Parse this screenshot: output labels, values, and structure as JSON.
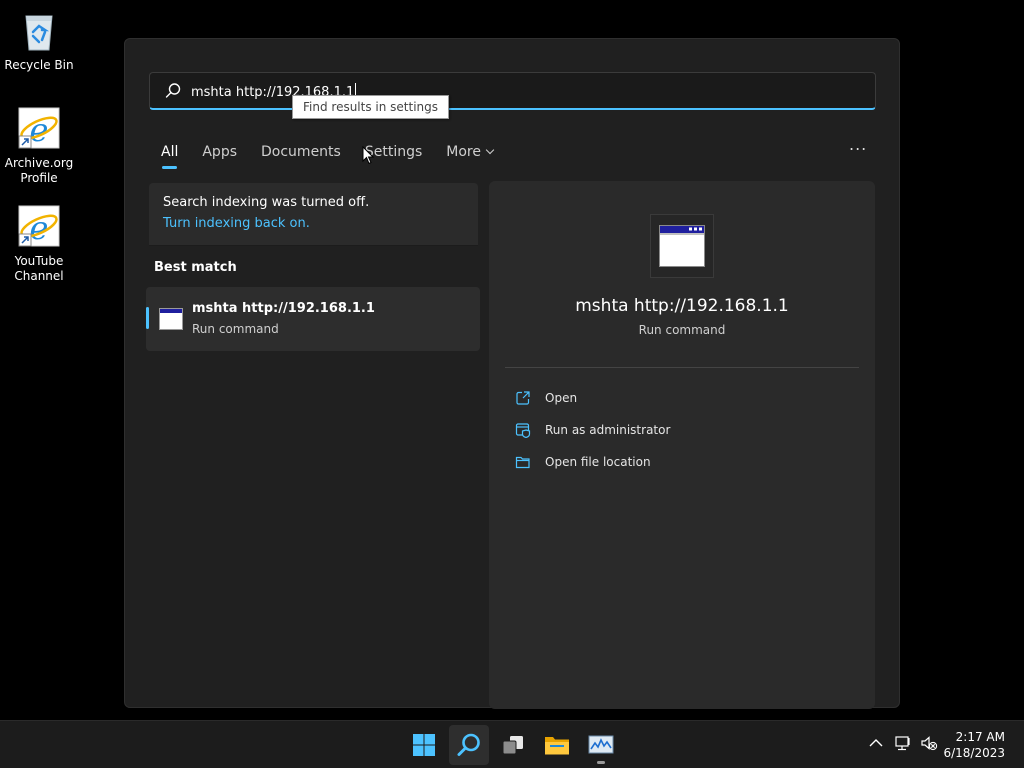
{
  "desktop": {
    "icons": [
      {
        "label": "Recycle Bin",
        "icon": "recycle-bin-icon"
      },
      {
        "label": "Archive.org Profile",
        "icon": "internet-explorer-icon"
      },
      {
        "label": "YouTube Channel",
        "icon": "internet-explorer-icon"
      }
    ]
  },
  "search": {
    "value": "mshta http://192.168.1.1",
    "icon": "search-icon",
    "accent_color": "#4cc2ff"
  },
  "tooltip": {
    "text": "Find results in settings"
  },
  "tabs": [
    {
      "label": "All",
      "active": true
    },
    {
      "label": "Apps"
    },
    {
      "label": "Documents"
    },
    {
      "label": "Settings"
    },
    {
      "label": "More"
    }
  ],
  "more_options": {
    "label": "..."
  },
  "indexing": {
    "message": "Search indexing was turned off.",
    "link": "Turn indexing back on."
  },
  "best_match": {
    "heading": "Best match",
    "item": {
      "name": "mshta http://192.168.1.1",
      "type": "Run command",
      "icon": "app-window-icon"
    }
  },
  "detail": {
    "name": "mshta http://192.168.1.1",
    "type": "Run command",
    "actions": [
      {
        "label": "Open",
        "icon": "open-external-icon"
      },
      {
        "label": "Run as administrator",
        "icon": "shield-admin-icon"
      },
      {
        "label": "Open file location",
        "icon": "folder-icon"
      }
    ]
  },
  "taskbar": {
    "apps": [
      "windows-start-icon",
      "search-icon",
      "task-view-icon",
      "file-explorer-icon",
      "task-manager-icon"
    ],
    "tray": [
      "chevron-up-icon",
      "network-icon",
      "volume-muted-icon"
    ],
    "clock": {
      "time": "2:17 AM",
      "date": "6/18/2023"
    }
  }
}
